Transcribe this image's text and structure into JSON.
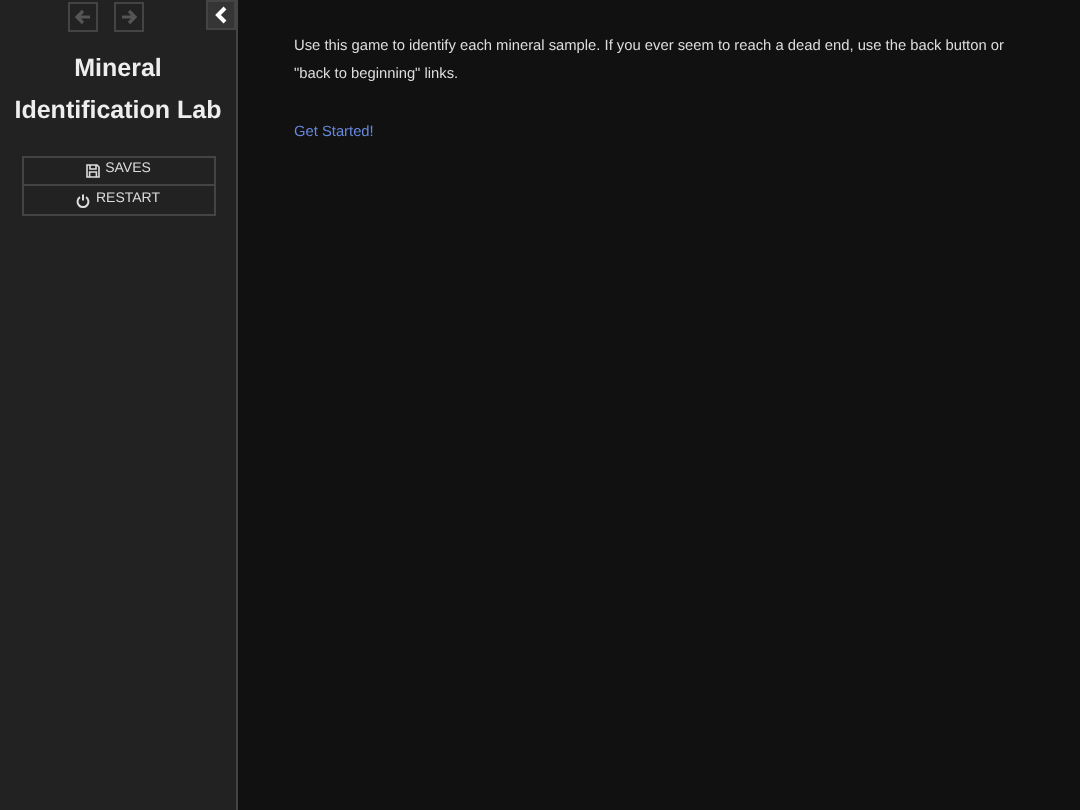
{
  "sidebar": {
    "history": [
      {
        "kind": "back",
        "disabled": true
      },
      {
        "kind": "forward",
        "disabled": true
      }
    ],
    "title_lines": [
      "Mineral",
      "Identification Lab"
    ],
    "menu": [
      {
        "kind": "saves",
        "label": "SAVES"
      },
      {
        "kind": "restart",
        "label": "RESTART"
      }
    ]
  },
  "passage": {
    "text": "Use this game to identify each mineral sample. If you ever seem to reach a dead end, use the back button or \"back to beginning\" links.",
    "link": "Get Started!"
  }
}
